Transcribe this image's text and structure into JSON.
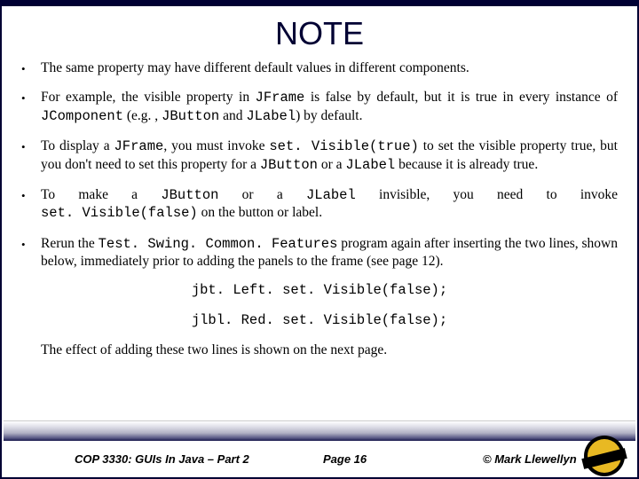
{
  "title": "NOTE",
  "bullets": [
    {
      "pre": "The same property may have different default values in different components."
    },
    {
      "pre": "For example, the visible property in ",
      "c1": "JFrame",
      "mid1": " is false by default, but it is true in every instance of ",
      "c2": "JComponent",
      "mid2": " (e.g. , ",
      "c3": "JButton",
      "mid3": " and ",
      "c4": "JLabel",
      "post": ") by default."
    },
    {
      "pre": "To display a ",
      "c1": "JFrame",
      "mid1": ", you must invoke ",
      "c2": "set. Visible(true)",
      "mid2": " to set the visible property true, but you don't need to set this property for a ",
      "c3": "JButton",
      "mid3": " or a ",
      "c4": "JLabel",
      "post": " because it is already true."
    },
    {
      "pre": "To make a ",
      "c1": "JButton",
      "mid1": " or a ",
      "c2": "JLabel",
      "mid2": " invisible, you need to invoke ",
      "c3": "set. Visible(false)",
      "post2": " on the button or label."
    },
    {
      "pre": "Rerun the ",
      "c1": "Test. Swing. Common. Features",
      "post": " program again after inserting the two lines, shown below, immediately prior to adding the panels to the frame (see page 12)."
    }
  ],
  "codeLines": [
    "jbt. Left. set. Visible(false);",
    "jlbl. Red. set. Visible(false);"
  ],
  "closing": "The effect of adding these two lines is shown on the next page.",
  "footer": {
    "course": "COP 3330: GUIs In Java – Part 2",
    "page": "Page 16",
    "copyright": "© Mark Llewellyn"
  }
}
